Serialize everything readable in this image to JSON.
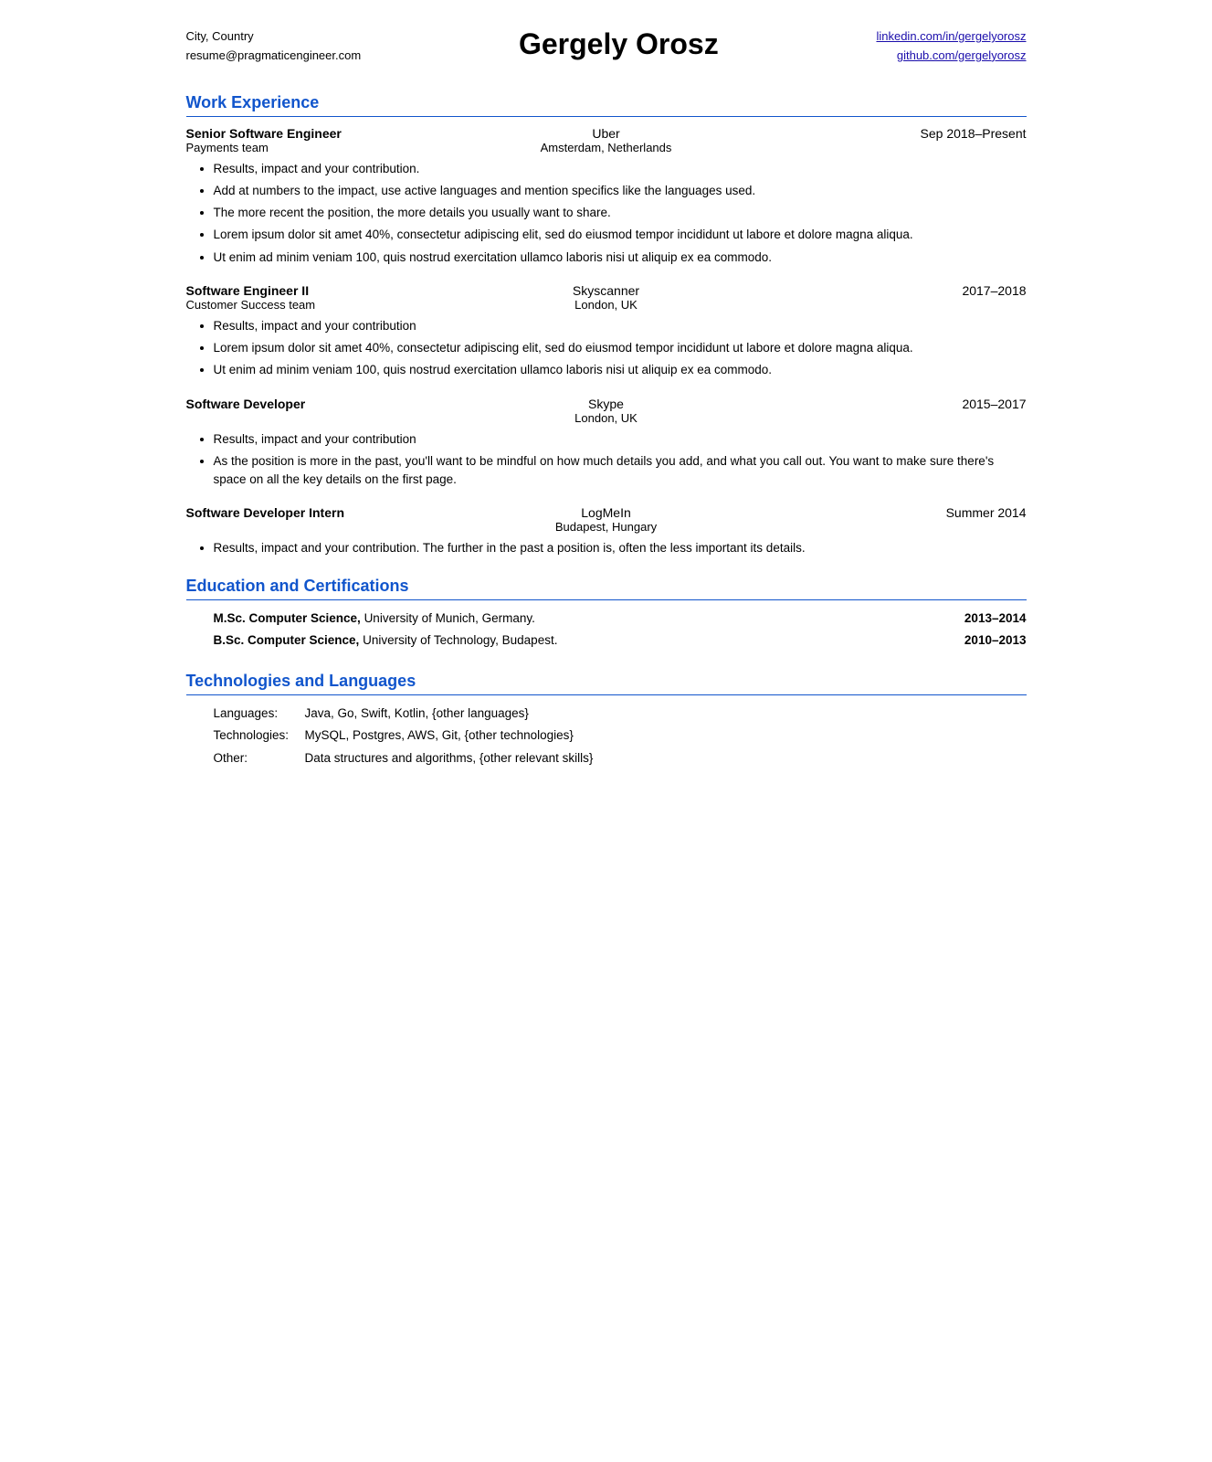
{
  "header": {
    "left_line1": "City, Country",
    "left_line2": "resume@pragmaticengineer.com",
    "name": "Gergely Orosz",
    "right_line1": "linkedin.com/in/gergelyorosz",
    "right_line2": "github.com/gergelyorosz"
  },
  "sections": {
    "work_experience": {
      "title": "Work Experience",
      "jobs": [
        {
          "title": "Senior Software Engineer",
          "company": "Uber",
          "date": "Sep 2018–Present",
          "team": "Payments team",
          "location": "Amsterdam, Netherlands",
          "bullets": [
            "Results, impact and your contribution.",
            "Add at numbers to the impact, use active languages and mention specifics like the languages used.",
            "The more recent the position, the more details you usually want to share.",
            "Lorem ipsum dolor sit amet 40%, consectetur adipiscing elit, sed do eiusmod tempor incididunt ut labore et dolore magna aliqua.",
            "Ut enim ad minim veniam 100, quis nostrud exercitation ullamco laboris nisi ut aliquip ex ea commodo."
          ]
        },
        {
          "title": "Software Engineer II",
          "company": "Skyscanner",
          "date": "2017–2018",
          "team": "Customer Success team",
          "location": "London, UK",
          "bullets": [
            "Results, impact and your contribution",
            "Lorem ipsum dolor sit amet 40%, consectetur adipiscing elit, sed do eiusmod tempor incididunt ut labore et dolore magna aliqua.",
            "Ut enim ad minim veniam 100, quis nostrud exercitation ullamco laboris nisi ut aliquip ex ea commodo."
          ]
        },
        {
          "title": "Software Developer",
          "company": "Skype",
          "date": "2015–2017",
          "team": "",
          "location": "London, UK",
          "bullets": [
            "Results, impact and your contribution",
            "As the position is more in the past, you'll want to be mindful on how much details you add, and what you call out. You want to make sure there's space on all the key details on the first page."
          ]
        },
        {
          "title": "Software Developer Intern",
          "company": "LogMeIn",
          "date": "Summer 2014",
          "team": "",
          "location": "Budapest, Hungary",
          "bullets": [
            "Results, impact and your contribution. The further in the past a position is, often the less important its details."
          ]
        }
      ]
    },
    "education": {
      "title": "Education and Certifications",
      "items": [
        {
          "text_bold": "M.Sc. Computer Science,",
          "text_normal": " University of Munich, Germany.",
          "date": "2013–2014"
        },
        {
          "text_bold": "B.Sc. Computer Science,",
          "text_normal": " University of Technology, Budapest.",
          "date": "2010–2013"
        },
        {
          "text_bold": "",
          "text_normal": "",
          "date": ""
        }
      ]
    },
    "technologies": {
      "title": "Technologies and Languages",
      "items": [
        {
          "label": "Languages:",
          "value": "Java, Go, Swift, Kotlin, {other languages}"
        },
        {
          "label": "Technologies:",
          "value": "MySQL, Postgres, AWS, Git, {other technologies}"
        },
        {
          "label": "Other:",
          "value": "Data structures and algorithms, {other relevant skills}"
        }
      ]
    }
  }
}
